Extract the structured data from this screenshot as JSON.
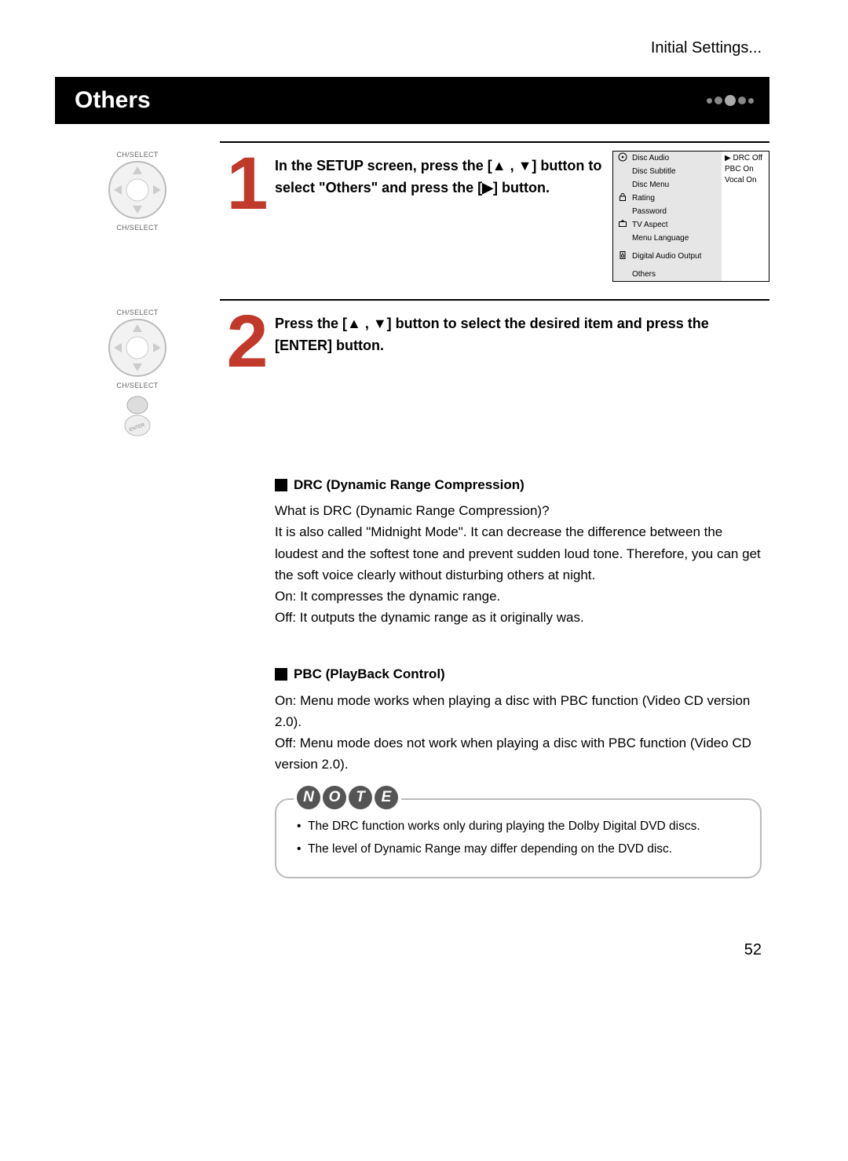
{
  "breadcrumb": "Initial Settings...",
  "title": "Others",
  "steps": {
    "s1": {
      "num": "1",
      "text_html": "In the SETUP screen, press the [▲ , ▼] button to select \"Others\" and press the [▶] button."
    },
    "s2": {
      "num": "2",
      "text_html": "Press the [▲ , ▼] button to select the desired item and press the [ENTER] button."
    }
  },
  "remote": {
    "chselect": "CH/SELECT",
    "enter": "ENTER"
  },
  "setup_menu": {
    "left": [
      "Disc Audio",
      "Disc Subtitle",
      "Disc Menu",
      "Rating",
      "Password",
      "TV Aspect",
      "Menu Language",
      "Digital Audio Output",
      "Others"
    ],
    "right": [
      "▶ DRC Off",
      "PBC On",
      "Vocal On"
    ]
  },
  "definitions": {
    "drc": {
      "title": "DRC (Dynamic Range Compression)",
      "q": "What is DRC (Dynamic Range Compression)?",
      "p1": "It is also called \"Midnight Mode\". It can decrease the difference between the loudest and the softest tone and prevent sudden loud tone. Therefore, you can get the soft voice clearly without disturbing others at night.",
      "on": "On: It compresses the dynamic range.",
      "off": "Off: It outputs the dynamic range as it originally was."
    },
    "pbc": {
      "title": "PBC (PlayBack Control)",
      "on": "On: Menu mode works when playing a disc with PBC function (Video CD version 2.0).",
      "off": "Off: Menu mode does not work when playing a disc with PBC function (Video CD version 2.0)."
    }
  },
  "note": {
    "label": [
      "N",
      "O",
      "T",
      "E"
    ],
    "items": [
      "The DRC function works only during playing the Dolby Digital DVD discs.",
      "The level of Dynamic Range may differ depending on the DVD disc."
    ]
  },
  "page_no": "52"
}
